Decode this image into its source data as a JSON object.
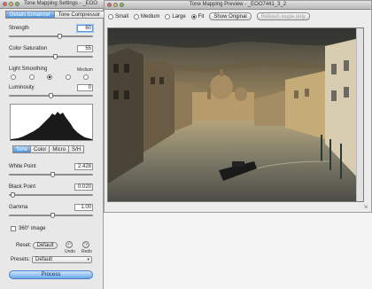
{
  "settings_window": {
    "title": "Tone Mapping Settings - _EOO",
    "tabs": [
      {
        "label": "Details Enhancer",
        "active": true
      },
      {
        "label": "Tone Compressor",
        "active": false
      }
    ],
    "strength": {
      "label": "Strength",
      "value": "60",
      "level": 0.6
    },
    "saturation": {
      "label": "Color Saturation",
      "value": "55",
      "level": 0.55
    },
    "light_smoothing": {
      "label": "Light Smoothing",
      "medium_label": "Medium",
      "options": 5,
      "selected_index": 2
    },
    "luminosity": {
      "label": "Luminosity",
      "value": "0",
      "level": 0.5
    },
    "subtabs": [
      {
        "label": "Tone",
        "active": true
      },
      {
        "label": "Color",
        "active": false
      },
      {
        "label": "Micro",
        "active": false
      },
      {
        "label": "S/H",
        "active": false
      }
    ],
    "white_point": {
      "label": "White Point",
      "value": "2.428",
      "level": 0.52
    },
    "black_point": {
      "label": "Black Point",
      "value": "0.020",
      "level": 0.04
    },
    "gamma": {
      "label": "Gamma",
      "value": "1.00",
      "level": 0.52
    },
    "image_360": {
      "label": "360° image",
      "checked": false
    },
    "reset": {
      "label": "Reset:",
      "button": "Default",
      "undo": "Undo",
      "redo": "Redo"
    },
    "presets": {
      "label": "Presets:",
      "value": "Default"
    },
    "process_button": "Process"
  },
  "preview_window": {
    "title": "Tone Mapping Preview - _EOO7441_3_2",
    "size_options": [
      {
        "label": "Small",
        "selected": false
      },
      {
        "label": "Medium",
        "selected": false
      },
      {
        "label": "Large",
        "selected": false
      },
      {
        "label": "Fit",
        "selected": true
      }
    ],
    "show_original": "Show Original",
    "refresh_loupe": "Refresh loupe only"
  },
  "colors": {
    "active_tab": "#4d8fd6",
    "process_button": "#6aa7e8",
    "sky": "#caa25a",
    "water": "#8a8a70"
  }
}
